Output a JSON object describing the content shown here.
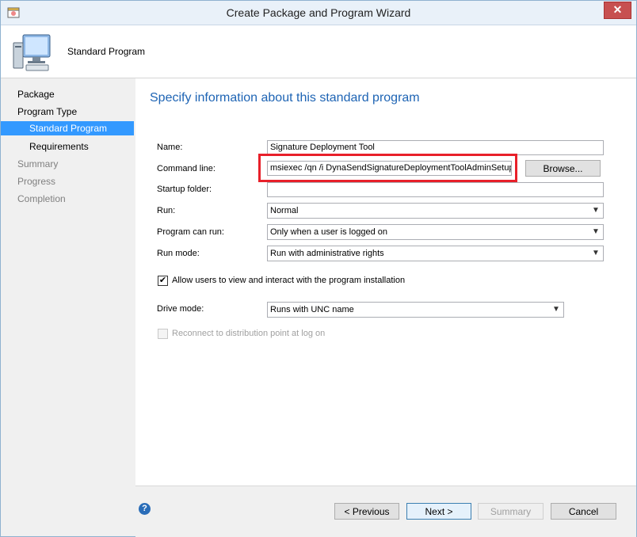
{
  "window": {
    "title": "Create Package and Program Wizard",
    "close_glyph": "✕",
    "accent": "#1e64b4"
  },
  "header": {
    "title": "Standard Program",
    "icon": "computer-icon"
  },
  "nav": {
    "items": [
      {
        "label": "Package",
        "level": 1,
        "state": "normal"
      },
      {
        "label": "Program Type",
        "level": 1,
        "state": "normal"
      },
      {
        "label": "Standard Program",
        "level": 2,
        "state": "selected"
      },
      {
        "label": "Requirements",
        "level": 2,
        "state": "normal"
      },
      {
        "label": "Summary",
        "level": 1,
        "state": "disabled"
      },
      {
        "label": "Progress",
        "level": 1,
        "state": "disabled"
      },
      {
        "label": "Completion",
        "level": 1,
        "state": "disabled"
      }
    ]
  },
  "content": {
    "title": "Specify information about this standard program",
    "name_label": "Name:",
    "name_value": "Signature Deployment Tool",
    "command_label": "Command line:",
    "command_value": "msiexec /qn /i DynaSendSignatureDeploymentToolAdminSetup.m",
    "browse_label": "Browse...",
    "startup_label": "Startup folder:",
    "startup_value": "",
    "run_label": "Run:",
    "run_value": "Normal",
    "can_run_label": "Program can run:",
    "can_run_value": "Only when a user is logged on",
    "run_mode_label": "Run mode:",
    "run_mode_value": "Run with administrative rights",
    "allow_interact_label": "Allow users to view and interact with the program installation",
    "allow_interact_checked": true,
    "drive_mode_label": "Drive mode:",
    "drive_mode_value": "Runs with UNC name",
    "reconnect_label": "Reconnect to distribution point at log on",
    "reconnect_checked": false,
    "dropdown_arrow": "▼",
    "check_glyph": "✔"
  },
  "footer": {
    "help_glyph": "?",
    "previous_label": "< Previous",
    "next_label": "Next >",
    "summary_label": "Summary",
    "cancel_label": "Cancel"
  }
}
